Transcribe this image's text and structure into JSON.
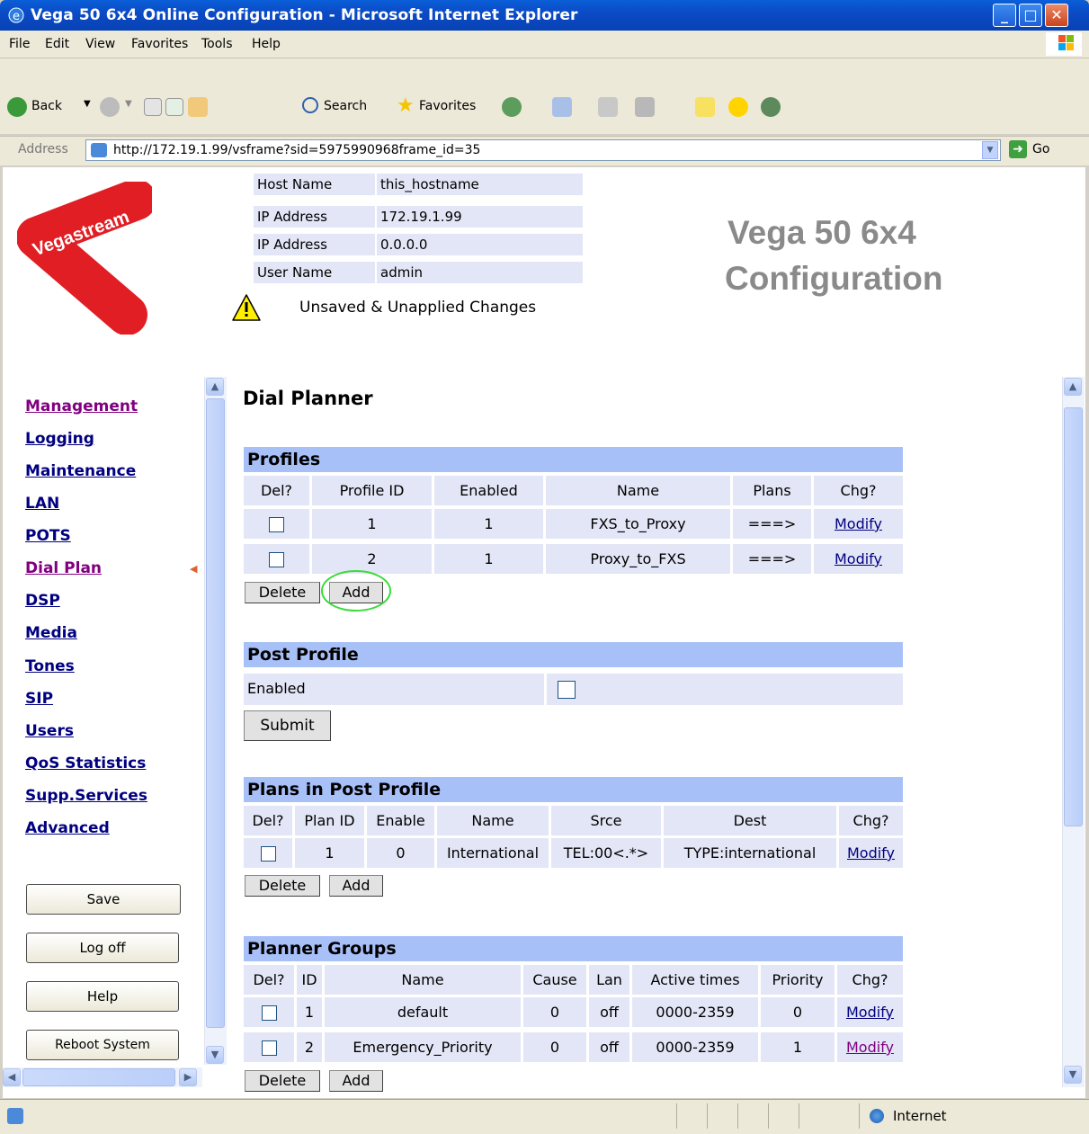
{
  "window": {
    "title": "Vega 50 6x4 Online Configuration - Microsoft Internet Explorer"
  },
  "menu": [
    "File",
    "Edit",
    "View",
    "Favorites",
    "Tools",
    "Help"
  ],
  "toolbar": {
    "back": "Back",
    "search": "Search",
    "favorites": "Favorites"
  },
  "address": {
    "label": "Address",
    "url": "http://172.19.1.99/vsframe?sid=5975990968frame_id=35",
    "go": "Go"
  },
  "logo": {
    "text": "Vegastream"
  },
  "host_info": [
    {
      "label": "Host Name",
      "value": "this_hostname"
    },
    {
      "label": "IP Address",
      "value": "172.19.1.99"
    },
    {
      "label": "IP Address",
      "value": "0.0.0.0"
    },
    {
      "label": "User Name",
      "value": "admin"
    }
  ],
  "warning": "Unsaved & Unapplied Changes",
  "config_title": {
    "line1": "Vega 50 6x4",
    "line2": "Configuration"
  },
  "nav": [
    "Management",
    "Logging",
    "Maintenance",
    "LAN",
    "POTS",
    "Dial Plan",
    "DSP",
    "Media",
    "Tones",
    "SIP",
    "Users",
    "QoS Statistics",
    "Supp.Services",
    "Advanced"
  ],
  "nav_active": "Dial Plan",
  "side_buttons": [
    "Save",
    "Log off",
    "Help",
    "Reboot System"
  ],
  "main": {
    "heading": "Dial Planner",
    "profiles": {
      "title": "Profiles",
      "headers": [
        "Del?",
        "Profile ID",
        "Enabled",
        "Name",
        "Plans",
        "Chg?"
      ],
      "rows": [
        {
          "id": "1",
          "enabled": "1",
          "name": "FXS_to_Proxy",
          "plans": "===>",
          "chg": "Modify"
        },
        {
          "id": "2",
          "enabled": "1",
          "name": "Proxy_to_FXS",
          "plans": "===>",
          "chg": "Modify"
        }
      ],
      "delete": "Delete",
      "add": "Add"
    },
    "post_profile": {
      "title": "Post Profile",
      "enabled_label": "Enabled",
      "submit": "Submit"
    },
    "plans": {
      "title": "Plans in Post Profile",
      "headers": [
        "Del?",
        "Plan ID",
        "Enable",
        "Name",
        "Srce",
        "Dest",
        "Chg?"
      ],
      "rows": [
        {
          "id": "1",
          "enable": "0",
          "name": "International",
          "srce": "TEL:00<.*>",
          "dest": "TYPE:international",
          "chg": "Modify"
        }
      ],
      "delete": "Delete",
      "add": "Add"
    },
    "groups": {
      "title": "Planner Groups",
      "headers": [
        "Del?",
        "ID",
        "Name",
        "Cause",
        "Lan",
        "Active times",
        "Priority",
        "Chg?"
      ],
      "rows": [
        {
          "id": "1",
          "name": "default",
          "cause": "0",
          "lan": "off",
          "times": "0000-2359",
          "priority": "0",
          "chg": "Modify"
        },
        {
          "id": "2",
          "name": "Emergency_Priority",
          "cause": "0",
          "lan": "off",
          "times": "0000-2359",
          "priority": "1",
          "chg": "Modify"
        }
      ],
      "delete": "Delete",
      "add": "Add"
    }
  },
  "status": {
    "zone": "Internet"
  }
}
